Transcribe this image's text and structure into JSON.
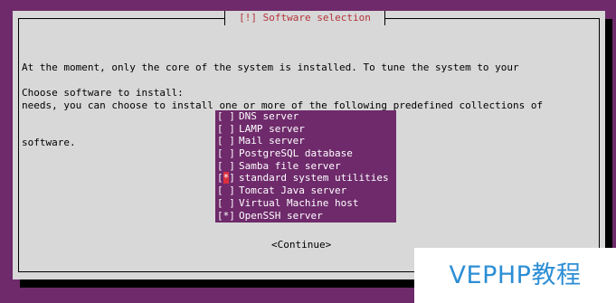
{
  "dialog": {
    "title": "[!] Software selection",
    "description_lines": [
      "At the moment, only the core of the system is installed. To tune the system to your",
      "needs, you can choose to install one or more of the following predefined collections of",
      "software."
    ],
    "prompt": "Choose software to install:",
    "continue_label": "<Continue>"
  },
  "software_list": [
    {
      "checkbox": "[ ]",
      "label": "DNS server",
      "selected": false,
      "focused": false
    },
    {
      "checkbox": "[ ]",
      "label": "LAMP server",
      "selected": false,
      "focused": false
    },
    {
      "checkbox": "[ ]",
      "label": "Mail server",
      "selected": false,
      "focused": false
    },
    {
      "checkbox": "[ ]",
      "label": "PostgreSQL database",
      "selected": false,
      "focused": false
    },
    {
      "checkbox": "[ ]",
      "label": "Samba file server",
      "selected": false,
      "focused": false
    },
    {
      "checkbox_prefix": "[",
      "checkbox_mark": "*",
      "checkbox_suffix": "]",
      "label": "standard system utilities",
      "selected": true,
      "focused": true
    },
    {
      "checkbox": "[ ]",
      "label": "Tomcat Java server",
      "selected": false,
      "focused": false
    },
    {
      "checkbox": "[ ]",
      "label": "Virtual Machine host",
      "selected": false,
      "focused": false
    },
    {
      "checkbox": "[*]",
      "label": "OpenSSH server",
      "selected": true,
      "focused": false
    }
  ],
  "watermark": {
    "text": "VEPHP教程"
  },
  "colors": {
    "background": "#6e2a6b",
    "dialog": "#d8d8d8",
    "title": "#b5323a",
    "cursor": "#d9303d",
    "watermark": "#2c8ed5"
  }
}
